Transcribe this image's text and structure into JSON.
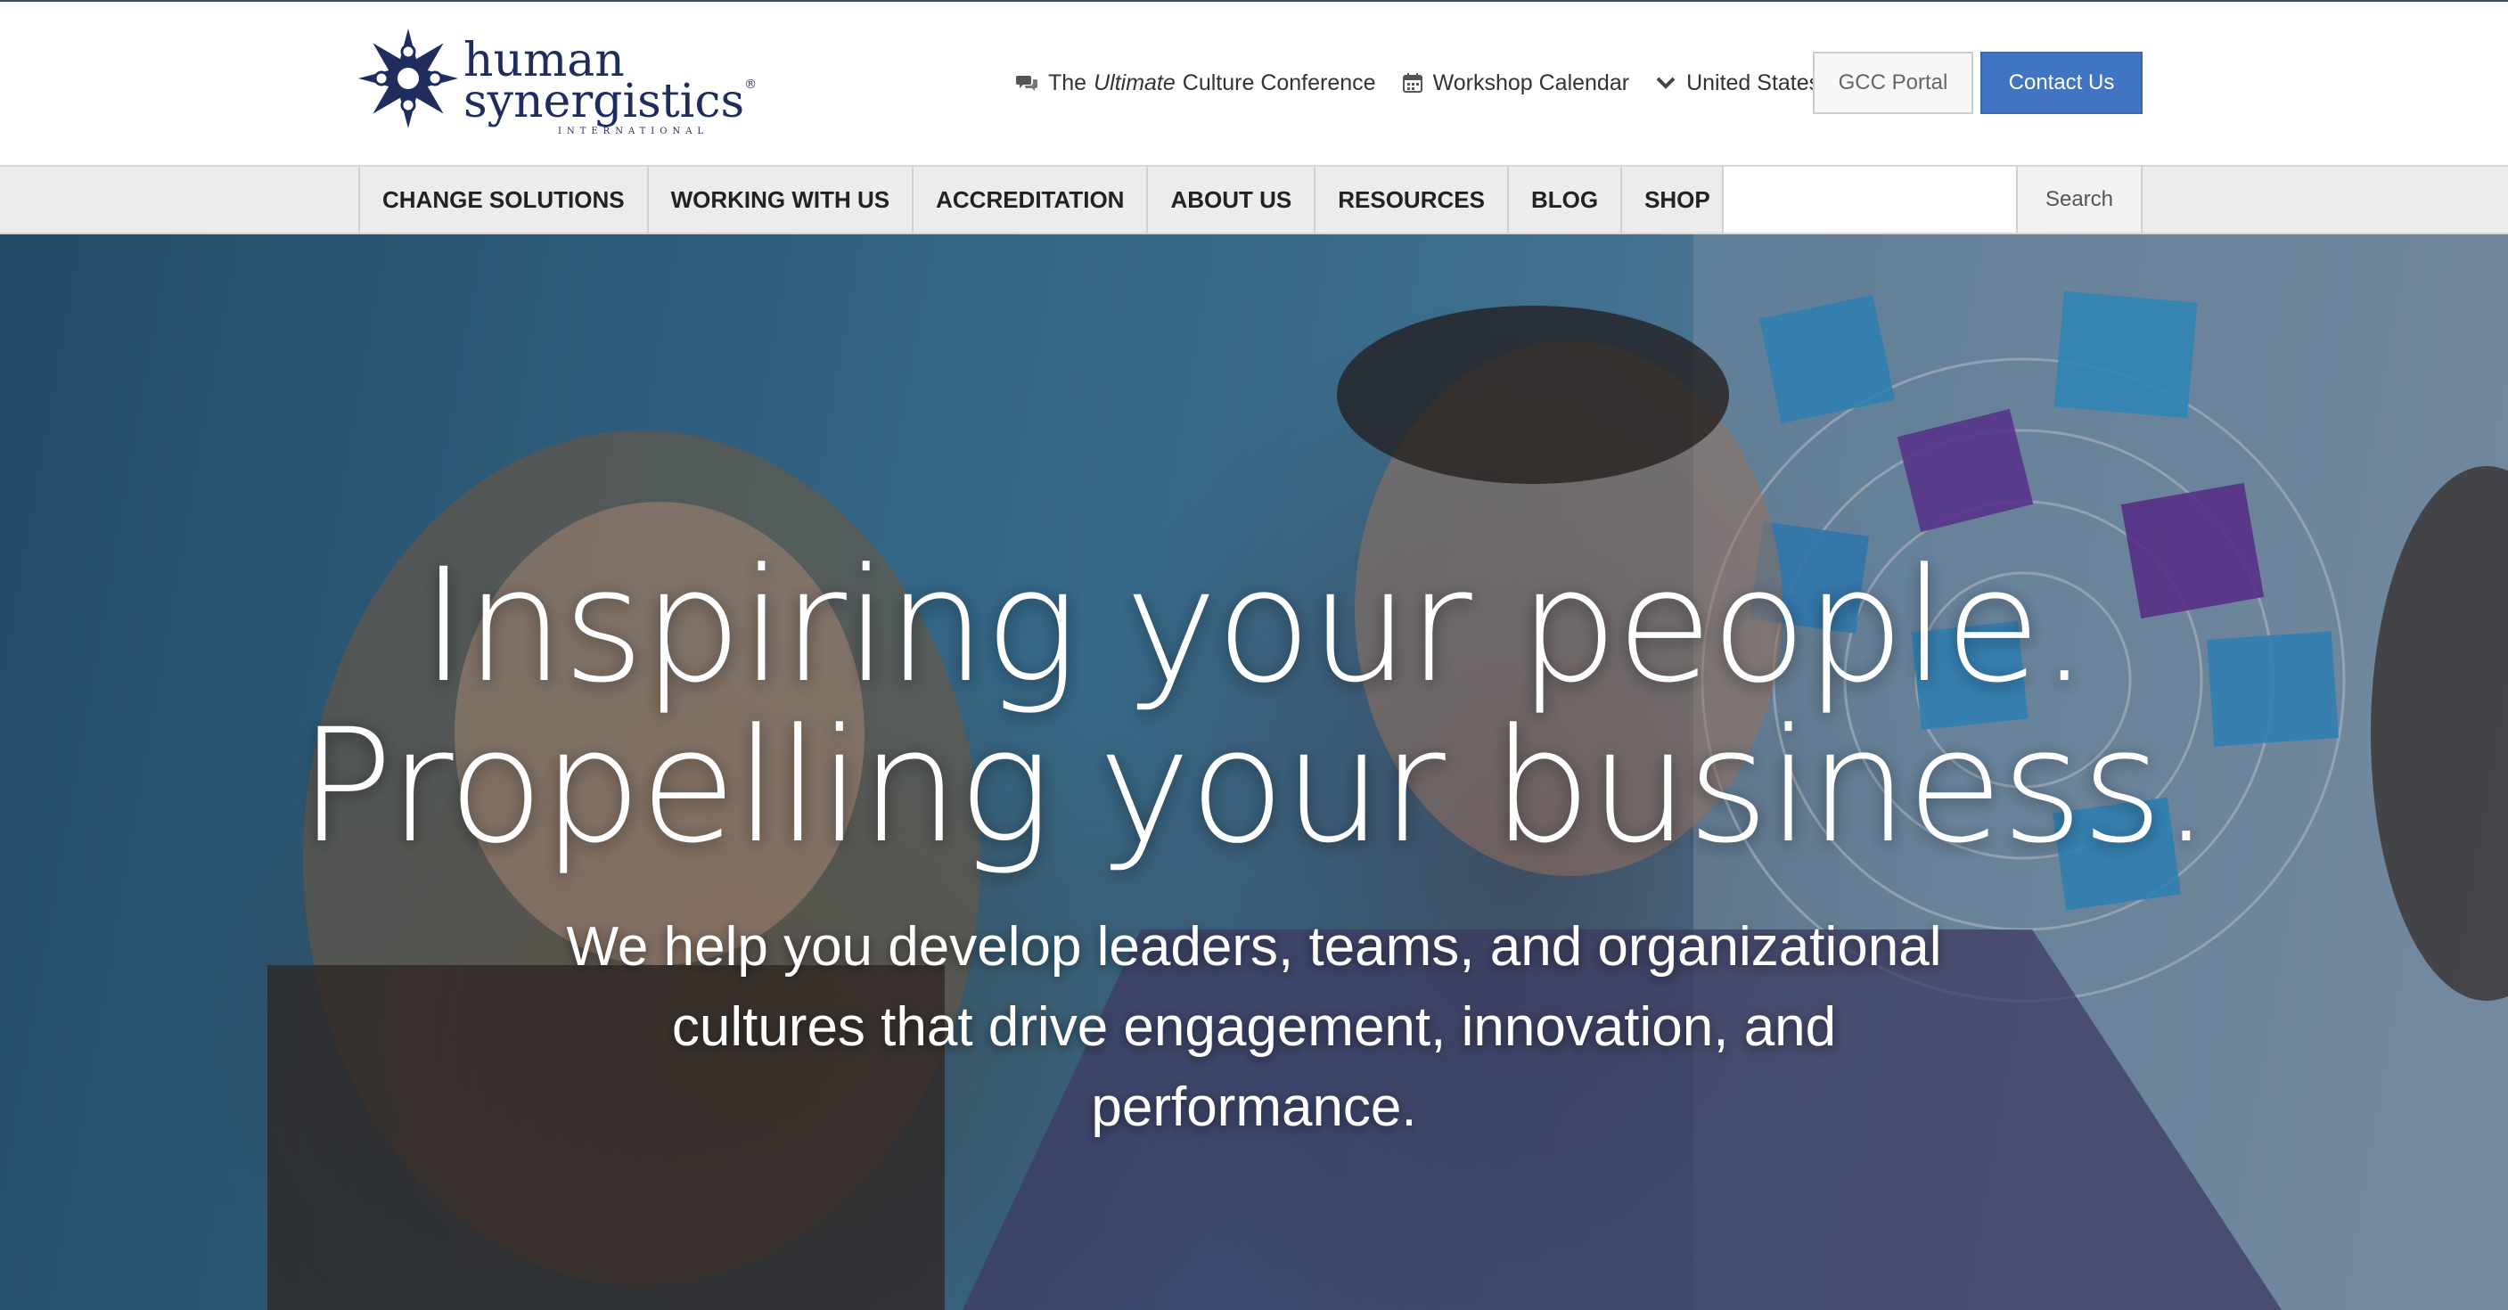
{
  "brand": {
    "name_line1": "human",
    "name_line2": "synergistics",
    "tagline": "INTERNATIONAL",
    "color": "#1e2d5e"
  },
  "utility": {
    "conference_prefix": "The",
    "conference_em": "Ultimate",
    "conference_suffix": "Culture Conference",
    "conference_icon": "chat-bubbles-icon",
    "workshop_label": "Workshop Calendar",
    "workshop_icon": "calendar-icon",
    "region_label": "United States",
    "region_icon": "chevron-down-icon"
  },
  "buttons": {
    "portal_label": "GCC Portal",
    "contact_label": "Contact Us",
    "contact_color": "#4175c2"
  },
  "nav": {
    "items": [
      {
        "label": "CHANGE SOLUTIONS"
      },
      {
        "label": "WORKING WITH US"
      },
      {
        "label": "ACCREDITATION"
      },
      {
        "label": "ABOUT US"
      },
      {
        "label": "RESOURCES"
      },
      {
        "label": "BLOG"
      },
      {
        "label": "SHOP"
      }
    ],
    "search_placeholder": "",
    "search_value": "",
    "search_button_label": "Search"
  },
  "hero": {
    "title_line1": "Inspiring your people.",
    "title_line2": "Propelling your business.",
    "subtitle": "We help you develop leaders, teams, and organizational cultures that drive engagement, innovation, and performance."
  }
}
